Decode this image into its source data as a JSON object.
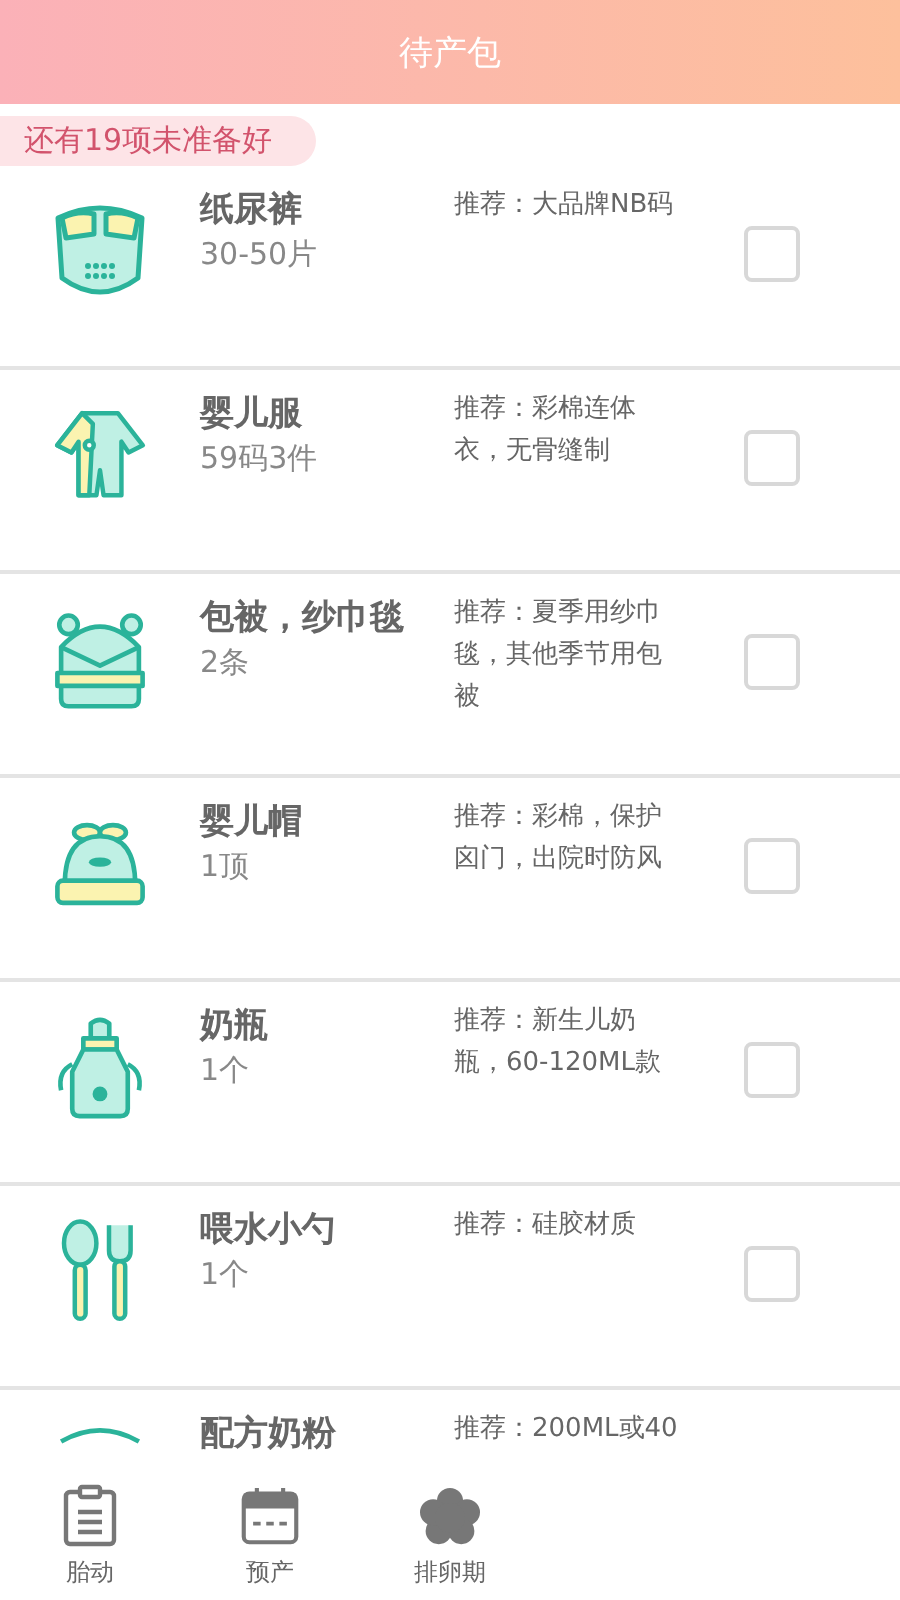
{
  "header": {
    "title": "待产包"
  },
  "banner": {
    "text": "还有19项未准备好"
  },
  "items": [
    {
      "kind": "diaper",
      "name": "纸尿裤",
      "quantity": "30-50片",
      "recommendation": "推荐：大品牌NB码",
      "checked": false
    },
    {
      "kind": "onesie",
      "name": "婴儿服",
      "quantity": "59码3件",
      "recommendation": "推荐：彩棉连体衣，无骨缝制",
      "checked": false
    },
    {
      "kind": "swaddle",
      "name": "包被，纱巾毯",
      "quantity": "2条",
      "recommendation": "推荐：夏季用纱巾毯，其他季节用包被",
      "checked": false
    },
    {
      "kind": "hat",
      "name": "婴儿帽",
      "quantity": "1顶",
      "recommendation": "推荐：彩棉，保护囟门，出院时防风",
      "checked": false
    },
    {
      "kind": "bottle",
      "name": "奶瓶",
      "quantity": "1个",
      "recommendation": "推荐：新生儿奶瓶，60-120ML款",
      "checked": false
    },
    {
      "kind": "utensils",
      "name": "喂水小勺",
      "quantity": "1个",
      "recommendation": "推荐：硅胶材质",
      "checked": false
    },
    {
      "kind": "can",
      "name": "配方奶粉",
      "recommendation": "推荐：200ML或40"
    }
  ],
  "tabs": [
    {
      "kind": "clipboard",
      "label": "胎动"
    },
    {
      "kind": "calendar",
      "label": "预产"
    },
    {
      "kind": "flower",
      "label": "排卵期"
    }
  ]
}
